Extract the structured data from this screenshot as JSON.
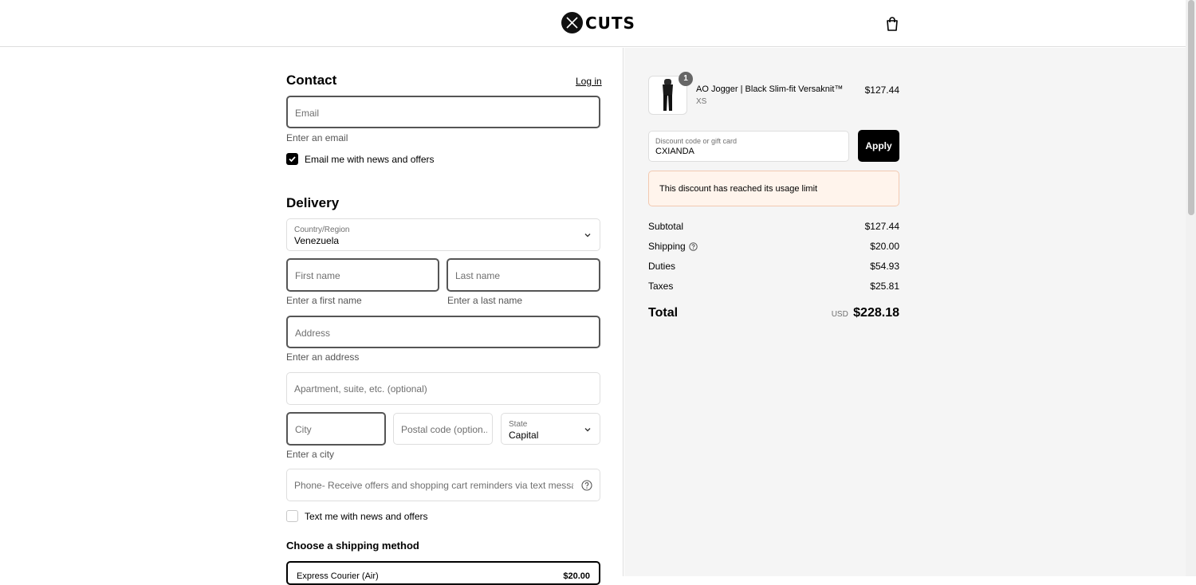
{
  "header": {
    "brand": "CUTS"
  },
  "contact": {
    "heading": "Contact",
    "login_label": "Log in",
    "email_placeholder": "Email",
    "email_error": "Enter an email",
    "newsletter_label": "Email me with news and offers"
  },
  "delivery": {
    "heading": "Delivery",
    "country_label": "Country/Region",
    "country_value": "Venezuela",
    "first_name_placeholder": "First name",
    "first_name_error": "Enter a first name",
    "last_name_placeholder": "Last name",
    "last_name_error": "Enter a last name",
    "address_placeholder": "Address",
    "address_error": "Enter an address",
    "apartment_placeholder": "Apartment, suite, etc. (optional)",
    "city_placeholder": "City",
    "city_error": "Enter a city",
    "postal_placeholder": "Postal code (option...",
    "state_label": "State",
    "state_value": "Capital",
    "phone_placeholder": "Phone- Receive offers and shopping cart reminders via text message",
    "sms_label": "Text me with news and offers"
  },
  "shipping": {
    "heading": "Choose a shipping method",
    "option_name": "Express Courier (Air)",
    "option_price": "$20.00"
  },
  "order": {
    "item_name": "AO Jogger | Black Slim-fit Versaknit™",
    "item_variant": "XS",
    "item_price": "$127.44",
    "item_qty": "1",
    "discount_label": "Discount code or gift card",
    "discount_value": "CXIANDA",
    "apply_label": "Apply",
    "discount_error": "This discount has reached its usage limit",
    "subtotal_label": "Subtotal",
    "subtotal_value": "$127.44",
    "shipping_label": "Shipping",
    "shipping_value": "$20.00",
    "duties_label": "Duties",
    "duties_value": "$54.93",
    "taxes_label": "Taxes",
    "taxes_value": "$25.81",
    "total_label": "Total",
    "total_currency": "USD",
    "total_value": "$228.18"
  },
  "colors": {
    "error_bg": "#fff4ec",
    "error_border": "#f2c9b1",
    "button_bg": "#000000"
  }
}
